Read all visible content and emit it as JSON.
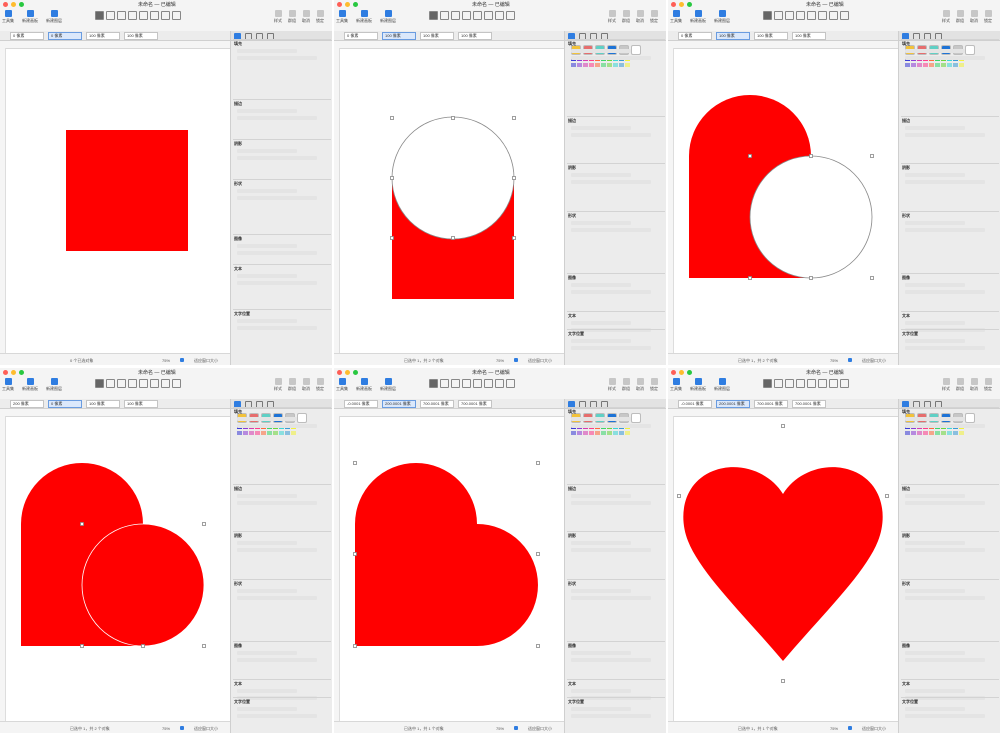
{
  "window": {
    "title": "未命名 — 已编辑",
    "document_tab": "画布 1"
  },
  "toolbar": {
    "left_buttons": [
      "工具集",
      "新建画板",
      "新建图层"
    ],
    "right_buttons": [
      "样式",
      "群组",
      "取消",
      "锁定"
    ]
  },
  "inspector": {
    "sections": [
      "填充",
      "描边",
      "阴影",
      "形状",
      "图像",
      "文本",
      "文字位置"
    ],
    "font_name": "Helvetica Neue"
  },
  "colors": {
    "shape_fill": "#ff0000",
    "accent": "#2f7de1",
    "swatch_big": [
      "#f2c23a",
      "#e66d6d",
      "#5fd0c5",
      "#1d73d6",
      "#c7c7c7",
      "#ffffff"
    ],
    "swatch_small": [
      "#3b3bd6",
      "#8a3bd6",
      "#d63bb0",
      "#ff3b8a",
      "#ff6a3b",
      "#3bd66a",
      "#6ad63b",
      "#3bd6d6",
      "#3b9ad6",
      "#f2f23b"
    ]
  },
  "panels": [
    {
      "step": 1,
      "shape": "square",
      "infobar": [
        "0 像素",
        "0 像素",
        "100 像素",
        "100 像素"
      ],
      "status": "0 个已选对象",
      "zoom": "75%",
      "fit": "适应窗口大小"
    },
    {
      "step": 2,
      "shape": "square-circle",
      "infobar": [
        "0 像素",
        "100 像素",
        "100 像素",
        "100 像素"
      ],
      "status": "已选中 1，共 2 个对象",
      "zoom": "75%",
      "fit": "适应窗口大小"
    },
    {
      "step": 3,
      "shape": "rounded-circle",
      "infobar": [
        "0 像素",
        "100 像素",
        "100 像素",
        "100 像素"
      ],
      "status": "已选中 1，共 2 个对象",
      "zoom": "75%",
      "fit": "适应窗口大小"
    },
    {
      "step": 4,
      "shape": "rounded-circle-2",
      "infobar": [
        "200 像素",
        "0 像素",
        "100 像素",
        "100 像素"
      ],
      "status": "已选中 1，共 2 个对象",
      "zoom": "75%",
      "fit": "适应窗口大小"
    },
    {
      "step": 5,
      "shape": "union",
      "infobar": [
        "-0.0001 像素",
        "200.0001 像素",
        "700.0001 像素",
        "700.0001 像素"
      ],
      "status": "已选中 1，共 1 个对象",
      "zoom": "75%",
      "fit": "适应窗口大小"
    },
    {
      "step": 6,
      "shape": "heart",
      "infobar": [
        "-0.0001 像素",
        "200.0001 像素",
        "700.0001 像素",
        "700.0001 像素"
      ],
      "status": "已选中 1，共 1 个对象",
      "zoom": "75%",
      "fit": "适应窗口大小"
    }
  ]
}
